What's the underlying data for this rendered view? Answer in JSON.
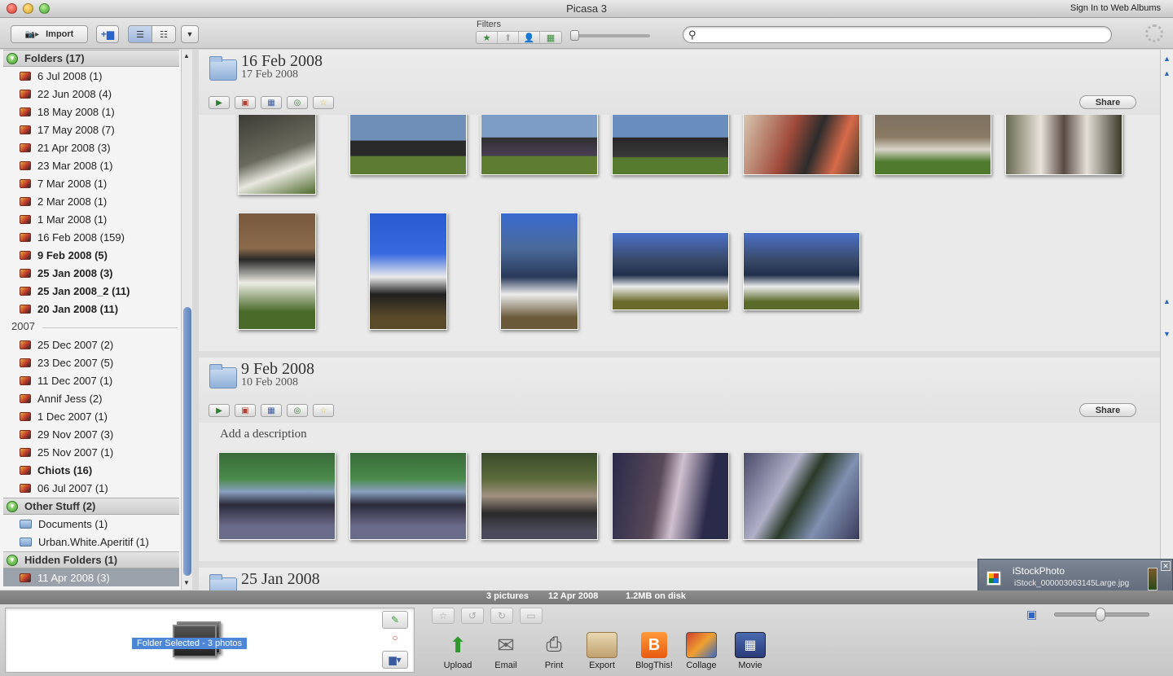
{
  "window": {
    "title": "Picasa 3",
    "signin": "Sign In to Web Albums"
  },
  "toolbar": {
    "import_label": "Import",
    "filters_label": "Filters",
    "search_placeholder": ""
  },
  "sidebar": {
    "folders_header": "Folders (17)",
    "folders": [
      {
        "label": "6 Jul 2008 (1)",
        "bold": false
      },
      {
        "label": "22 Jun 2008 (4)",
        "bold": false
      },
      {
        "label": "18 May 2008 (1)",
        "bold": false
      },
      {
        "label": "17 May 2008 (7)",
        "bold": false
      },
      {
        "label": "21 Apr 2008 (3)",
        "bold": false
      },
      {
        "label": "23 Mar 2008 (1)",
        "bold": false
      },
      {
        "label": "7 Mar 2008 (1)",
        "bold": false
      },
      {
        "label": "2 Mar 2008 (1)",
        "bold": false
      },
      {
        "label": "1 Mar 2008 (1)",
        "bold": false
      },
      {
        "label": "16 Feb 2008 (159)",
        "bold": false
      },
      {
        "label": "9 Feb 2008 (5)",
        "bold": true
      },
      {
        "label": "25 Jan 2008 (3)",
        "bold": true
      },
      {
        "label": "25 Jan 2008_2 (11)",
        "bold": true
      },
      {
        "label": "20 Jan 2008 (11)",
        "bold": true
      }
    ],
    "year_2007": "2007",
    "folders_2007": [
      {
        "label": "25 Dec 2007 (2)",
        "bold": false
      },
      {
        "label": "23 Dec 2007 (5)",
        "bold": false
      },
      {
        "label": "11 Dec 2007 (1)",
        "bold": false
      },
      {
        "label": "Annif Jess (2)",
        "bold": false
      },
      {
        "label": "1 Dec 2007 (1)",
        "bold": false
      },
      {
        "label": "29 Nov 2007 (3)",
        "bold": false
      },
      {
        "label": "25 Nov 2007 (1)",
        "bold": false
      },
      {
        "label": "Chiots (16)",
        "bold": true
      },
      {
        "label": "06 Jul 2007 (1)",
        "bold": false
      }
    ],
    "other_header": "Other Stuff (2)",
    "other": [
      {
        "label": "Documents (1)"
      },
      {
        "label": "Urban.White.Aperitif (1)"
      }
    ],
    "hidden_header": "Hidden Folders (1)",
    "hidden": [
      {
        "label": "11 Apr 2008 (3)"
      }
    ]
  },
  "main": {
    "folder1": {
      "title": "16 Feb 2008",
      "subtitle": "17 Feb 2008",
      "share": "Share"
    },
    "folder2": {
      "title": "9 Feb 2008",
      "subtitle": "10 Feb 2008",
      "share": "Share",
      "description": "Add a description"
    },
    "folder3": {
      "title": "25 Jan 2008"
    }
  },
  "istock": {
    "title": "iStockPhoto",
    "file": "iStock_000003063145Large.jpg"
  },
  "status": {
    "count": "3 pictures",
    "date": "12 Apr 2008",
    "size": "1.2MB on disk"
  },
  "tray": {
    "selection": "Folder Selected - 3 photos",
    "actions": [
      {
        "label": "Upload",
        "icon": "upload-arrow-icon"
      },
      {
        "label": "Email",
        "icon": "envelope-icon"
      },
      {
        "label": "Print",
        "icon": "printer-icon"
      },
      {
        "label": "Export",
        "icon": "folder-export-icon"
      },
      {
        "label": "BlogThis!",
        "icon": "blogger-icon"
      },
      {
        "label": "Collage",
        "icon": "collage-icon"
      },
      {
        "label": "Movie",
        "icon": "film-icon"
      }
    ]
  },
  "colors": {
    "selection_blue": "#4d86d6",
    "sidebar_selected": "#9aa1ab",
    "accent_green": "#3f9b2c"
  }
}
